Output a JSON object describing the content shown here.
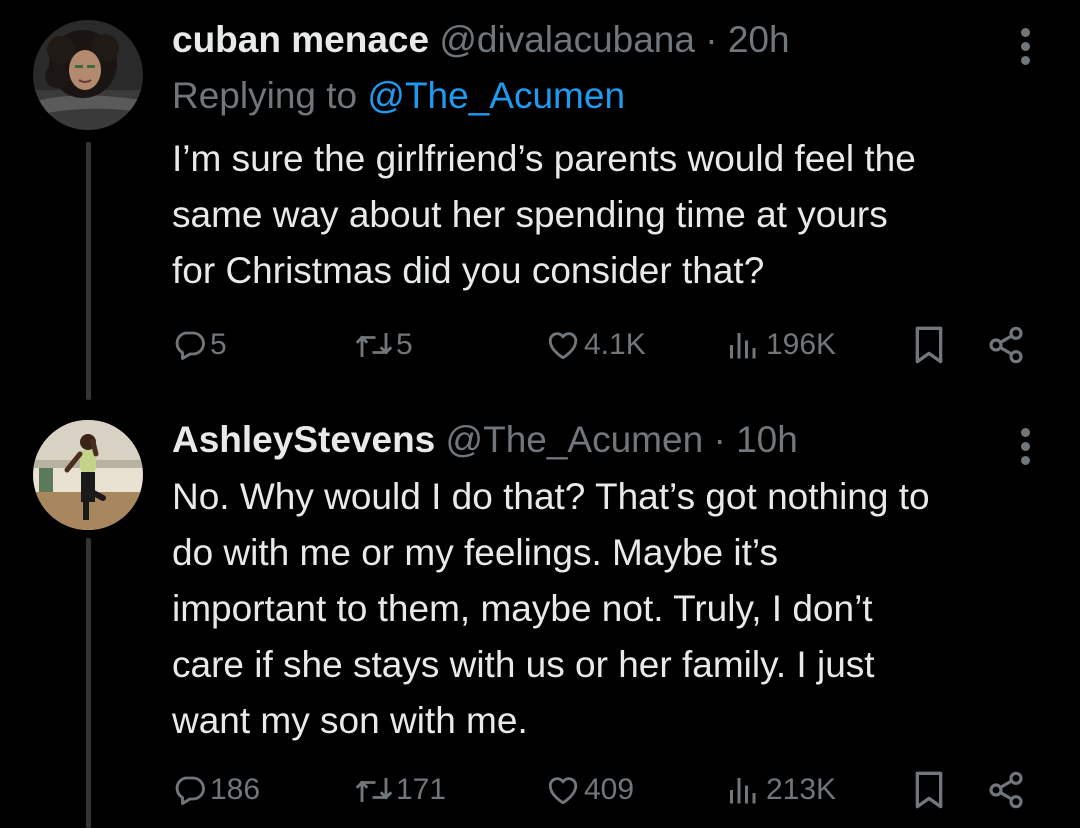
{
  "tweets": [
    {
      "display_name": "cuban menace",
      "handle": "@divalacubana",
      "separator": "·",
      "time": "20h",
      "replying_prefix": "Replying to",
      "replying_to": "@The_Acumen",
      "text_lines": [
        "I’m sure the girlfriend’s parents would feel the",
        "same way about her spending time at yours",
        "for Christmas did you consider that?"
      ],
      "stats": {
        "replies": "5",
        "reposts": "5",
        "likes": "4.1K",
        "views": "196K"
      }
    },
    {
      "display_name": "AshleyStevens",
      "handle": "@The_Acumen",
      "separator": "·",
      "time": "10h",
      "text_lines": [
        "No. Why would I do that? That’s got nothing to",
        "do with me or my feelings. Maybe it’s",
        "important to them, maybe not. Truly, I don’t",
        "care if she stays with us or her family. I just",
        "want my son with me."
      ],
      "stats": {
        "replies": "186",
        "reposts": "171",
        "likes": "409",
        "views": "213K"
      }
    }
  ],
  "icons": {
    "reply": "reply-icon",
    "repost": "repost-icon",
    "like": "heart-icon",
    "views": "views-icon",
    "bookmark": "bookmark-icon",
    "share": "share-icon",
    "more": "more-icon"
  },
  "colors": {
    "background": "#000000",
    "text": "#e7e9ea",
    "secondary": "#71767b",
    "link": "#1d9bf0",
    "thread_line": "#333639"
  }
}
